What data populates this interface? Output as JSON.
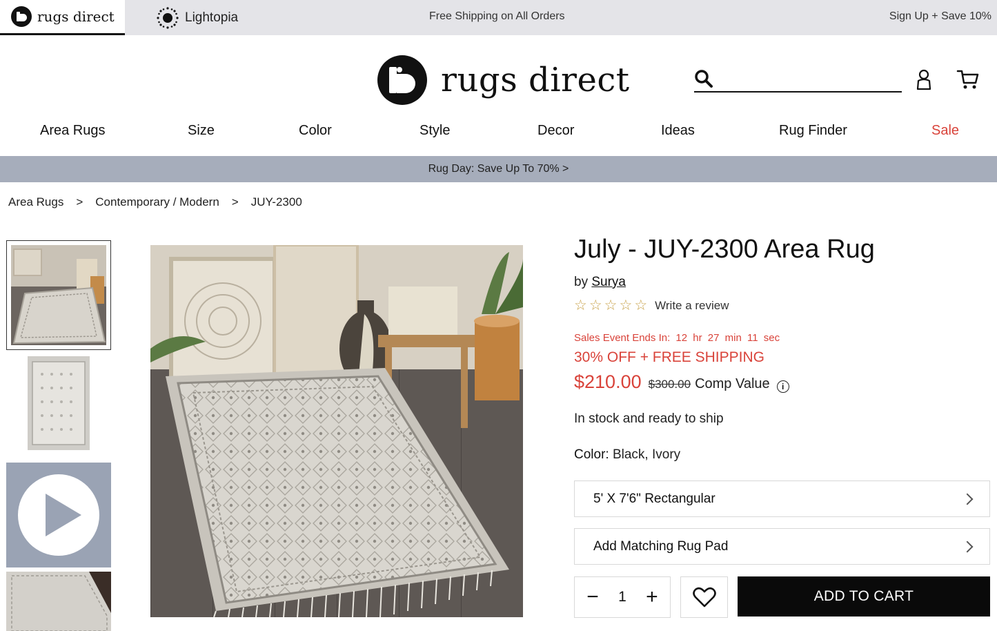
{
  "topbar": {
    "tabs": [
      {
        "label": "rugs direct",
        "active": true
      },
      {
        "label": "Lightopia",
        "active": false
      }
    ],
    "shipping_text": "Free Shipping on All Orders",
    "signup_text": "Sign Up + Save 10%"
  },
  "header": {
    "logo_text": "rugs direct",
    "search_placeholder": ""
  },
  "nav": {
    "items": [
      "Area Rugs",
      "Size",
      "Color",
      "Style",
      "Decor",
      "Ideas",
      "Rug Finder",
      "Sale"
    ]
  },
  "promo": {
    "text": "Rug Day: Save Up To 70% >"
  },
  "breadcrumb": {
    "items": [
      "Area Rugs",
      "Contemporary / Modern",
      "JUY-2300"
    ],
    "separator": ">"
  },
  "product": {
    "title": "July - JUY-2300 Area Rug",
    "by_label": "by",
    "brand": "Surya",
    "rating_stars": 0,
    "rating_max": 5,
    "review_link": "Write a review",
    "sale_ends_label": "Sales Event Ends In:",
    "countdown": {
      "hours": "12",
      "hr_label": "hr",
      "minutes": "27",
      "min_label": "min",
      "seconds": "11",
      "sec_label": "sec"
    },
    "offer_text": "30% OFF + FREE SHIPPING",
    "price": "$210.00",
    "comp_price": "$300.00",
    "comp_label": "Comp Value",
    "info_symbol": "i",
    "stock_text": "In stock and ready to ship",
    "color_label": "Color:",
    "color_value": "Black, Ivory",
    "size_option": "5' X 7'6\" Rectangular",
    "pad_option": "Add Matching Rug Pad",
    "quantity": "1",
    "minus_symbol": "−",
    "plus_symbol": "+",
    "add_to_cart": "ADD TO CART"
  },
  "colors": {
    "accent_red": "#d9433a",
    "topbar_bg": "#e4e4e8",
    "promo_bg": "#a6adbb",
    "button_bg": "#0a0a0a"
  }
}
